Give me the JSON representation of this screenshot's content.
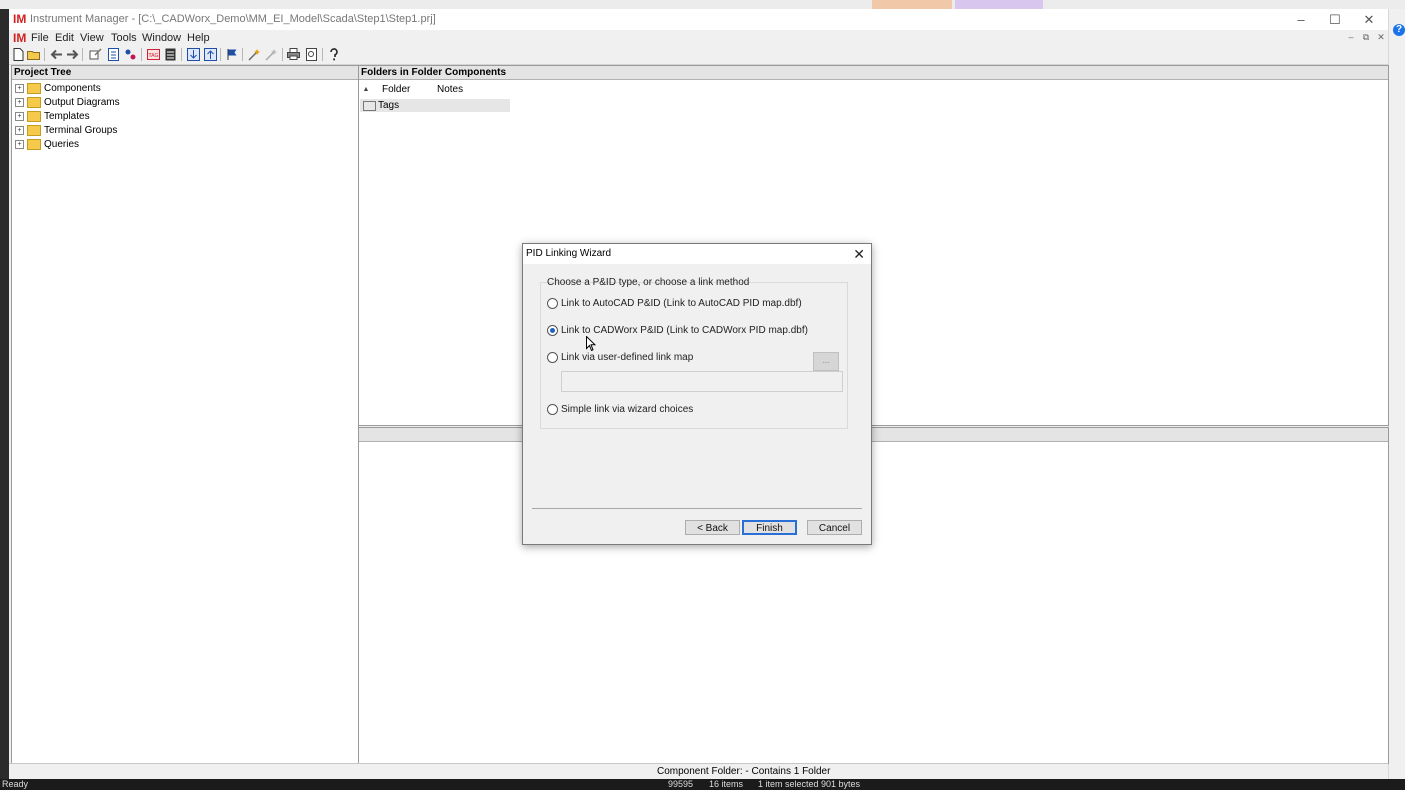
{
  "app": {
    "logo_text": "IM",
    "window_title": "Instrument Manager - [C:\\_CADWorx_Demo\\MM_EI_Model\\Scada\\Step1\\Step1.prj]"
  },
  "menu": [
    "File",
    "Edit",
    "View",
    "Tools",
    "Window",
    "Help"
  ],
  "toolbar_icons": [
    "new-icon",
    "open-icon",
    "back-icon",
    "forward-icon",
    "edit-icon",
    "properties-icon",
    "link-icon",
    "tag-icon",
    "report-icon",
    "import-icon",
    "export-icon",
    "flag-icon",
    "wizard-icon",
    "filter-icon",
    "print-icon",
    "print-preview-icon",
    "help-icon"
  ],
  "project_tree": {
    "header": "Project Tree",
    "items": [
      "Components",
      "Output Diagrams",
      "Templates",
      "Terminal Groups",
      "Queries"
    ]
  },
  "folder_pane": {
    "header": "Folders in Folder Components",
    "columns": [
      "Folder",
      "Notes"
    ],
    "rows": [
      {
        "folder": "Tags",
        "notes": ""
      }
    ]
  },
  "status": {
    "component_folder": "Component Folder:  - Contains 1 Folder"
  },
  "taskbar": {
    "ready": "Ready",
    "items": "16 items",
    "selected": "1 item selected  901 bytes",
    "code": "99595"
  },
  "dialog": {
    "title": "PID Linking Wizard",
    "group_label": "Choose a P&ID type, or choose a link method",
    "options": [
      {
        "label": "Link to AutoCAD P&ID (Link to AutoCAD PID map.dbf)",
        "selected": false
      },
      {
        "label": "Link to CADWorx P&ID (Link to CADWorx PID map.dbf)",
        "selected": true
      },
      {
        "label": "Link via user-defined link map",
        "selected": false
      },
      {
        "label": "Simple link via wizard choices",
        "selected": false
      }
    ],
    "browse_label": "...",
    "map_path_value": "",
    "buttons": {
      "back": "< Back",
      "finish": "Finish",
      "cancel": "Cancel"
    }
  },
  "colors": {
    "brand_red": "#d31f1f",
    "selection_blue": "#1e63c4",
    "folder_yellow": "#f5c94a"
  }
}
